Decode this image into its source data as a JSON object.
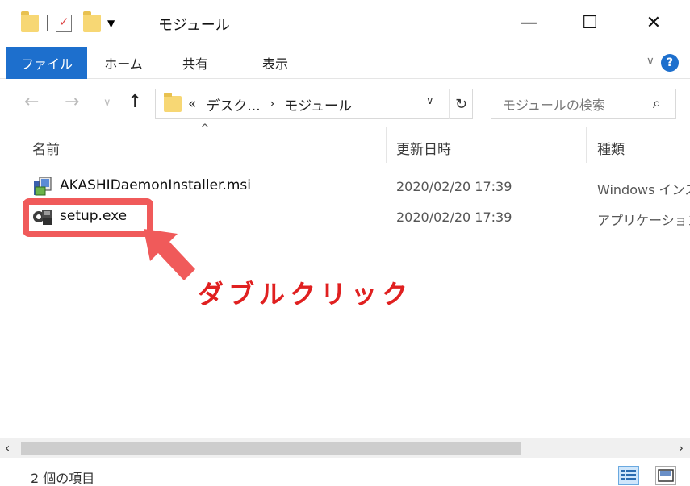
{
  "window": {
    "title": "モジュール",
    "minimize": "—",
    "maximize": "☐",
    "close": "✕"
  },
  "ribbon": {
    "tabs": [
      "ファイル",
      "ホーム",
      "共有",
      "表示"
    ],
    "help": "?"
  },
  "address": {
    "overflow": "«",
    "crumbs": [
      "デスク...",
      "›",
      "モジュール"
    ],
    "search_placeholder": "モジュールの検索"
  },
  "columns": [
    "名前",
    "更新日時",
    "種類"
  ],
  "files": [
    {
      "name": "AKASHIDaemonInstaller.msi",
      "date": "2020/02/20 17:39",
      "type": "Windows インストーラー パッケージ",
      "icon": "msi-installer-icon"
    },
    {
      "name": "setup.exe",
      "date": "2020/02/20 17:39",
      "type": "アプリケーション",
      "icon": "setup-exe-icon"
    }
  ],
  "annotation": {
    "text": "ダブルクリック",
    "color": "#e02020"
  },
  "status": {
    "count": "2 個の項目"
  },
  "colors": {
    "accent": "#1d6fcd",
    "highlight": "#f05a5a"
  }
}
